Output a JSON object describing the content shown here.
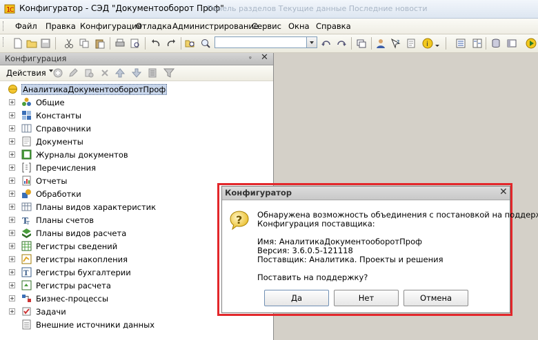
{
  "window": {
    "title": "Конфигуратор - СЭД \"Документооборот Проф\"",
    "ghost_tabs": "Панель разделов     Текущие данные     Последние новости"
  },
  "menu": [
    "Файл",
    "Правка",
    "Конфигурация",
    "Отладка",
    "Администрирование",
    "Сервис",
    "Окна",
    "Справка"
  ],
  "toolbar": {
    "search_value": ""
  },
  "panel": {
    "title": "Конфигурация",
    "pin": "ᵩ",
    "close": "✕",
    "actions_label": "Действия",
    "root_label": "АналитикаДокументооборотПроф",
    "items": [
      "Общие",
      "Константы",
      "Справочники",
      "Документы",
      "Журналы документов",
      "Перечисления",
      "Отчеты",
      "Обработки",
      "Планы видов характеристик",
      "Планы счетов",
      "Планы видов расчета",
      "Регистры сведений",
      "Регистры накопления",
      "Регистры бухгалтерии",
      "Регистры расчета",
      "Бизнес-процессы",
      "Задачи",
      "Внешние источники данных"
    ]
  },
  "dialog": {
    "title": "Конфигуратор",
    "close": "✕",
    "line1": "Обнаружена возможность объединения с постановкой на поддержку.",
    "line2": "Конфигурация поставщика:",
    "name_line": "Имя: АналитикаДокументооборотПроф",
    "version_line": "Версия: 3.6.0.5-121118",
    "vendor_line": "Поставщик: Аналитика. Проекты и решения",
    "question": "Поставить на поддержку?",
    "buttons": {
      "yes": "Да",
      "no": "Нет",
      "cancel": "Отмена"
    }
  },
  "colors": {
    "highlight": "#e2262a",
    "workspace": "#d4d0c8",
    "selection": "#c7d5ea"
  }
}
